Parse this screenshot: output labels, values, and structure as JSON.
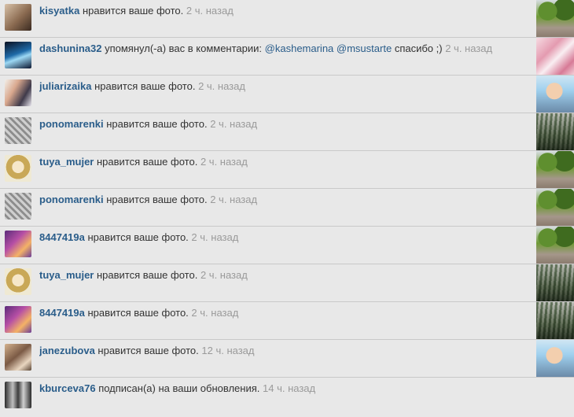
{
  "notifications": [
    {
      "user": "kisyatka",
      "text": "нравится ваше фото.",
      "time": "2 ч. назад",
      "avatar": "photo",
      "thumb": "park"
    },
    {
      "user": "dashunina32",
      "text_before": "упомянул(-а) вас в комментарии:",
      "mention1": "@kashemarina",
      "mention2": "@msustarte",
      "text_after": "спасибо ;)",
      "time": "2 ч. назад",
      "avatar": "photo",
      "thumb": "pink"
    },
    {
      "user": "juliarizaika",
      "text": "нравится ваше фото.",
      "time": "2 ч. назад",
      "avatar": "photo",
      "thumb": "child"
    },
    {
      "user": "ponomarenki",
      "text": "нравится ваше фото.",
      "time": "2 ч. назад",
      "avatar": "photo",
      "thumb": "trees"
    },
    {
      "user": "tuya_mujer",
      "text": "нравится ваше фото.",
      "time": "2 ч. назад",
      "avatar": "photo",
      "thumb": "park"
    },
    {
      "user": "ponomarenki",
      "text": "нравится ваше фото.",
      "time": "2 ч. назад",
      "avatar": "photo",
      "thumb": "park"
    },
    {
      "user": "8447419a",
      "text": "нравится ваше фото.",
      "time": "2 ч. назад",
      "avatar": "photo",
      "thumb": "park"
    },
    {
      "user": "tuya_mujer",
      "text": "нравится ваше фото.",
      "time": "2 ч. назад",
      "avatar": "photo",
      "thumb": "trees"
    },
    {
      "user": "8447419a",
      "text": "нравится ваше фото.",
      "time": "2 ч. назад",
      "avatar": "photo",
      "thumb": "trees"
    },
    {
      "user": "janezubova",
      "text": "нравится ваше фото.",
      "time": "12 ч. назад",
      "avatar": "photo",
      "thumb": "child"
    },
    {
      "user": "kburceva76",
      "text": "подписан(а) на ваши обновления.",
      "time": "14 ч. назад",
      "avatar": "photo"
    }
  ],
  "colors": {
    "username": "#2a5d8a",
    "time": "#9a9a9a",
    "background": "#e8e8e8"
  }
}
